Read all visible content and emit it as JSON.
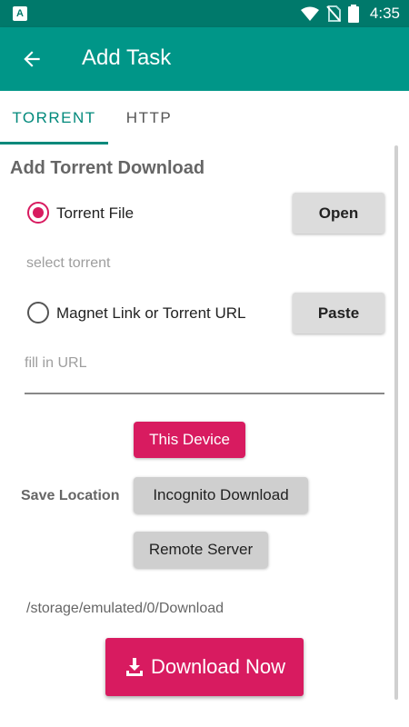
{
  "status_bar": {
    "time": "4:35"
  },
  "app_bar": {
    "title": "Add Task"
  },
  "tabs": [
    {
      "label": "TORRENT",
      "active": true
    },
    {
      "label": "HTTP",
      "active": false
    }
  ],
  "section_title": "Add Torrent Download",
  "torrent_file": {
    "label": "Torrent File",
    "checked": true,
    "button": "Open",
    "hint": "select torrent"
  },
  "magnet": {
    "label": "Magnet Link or Torrent URL",
    "checked": false,
    "button": "Paste",
    "placeholder": "fill in URL"
  },
  "save_location": {
    "label": "Save Location",
    "options": [
      "This Device",
      "Incognito Download",
      "Remote Server"
    ],
    "selected": "This Device",
    "path": "/storage/emulated/0/Download"
  },
  "download_button": "Download Now",
  "colors": {
    "primary": "#009688",
    "status_bar": "#00796b",
    "accent": "#d81b60"
  }
}
